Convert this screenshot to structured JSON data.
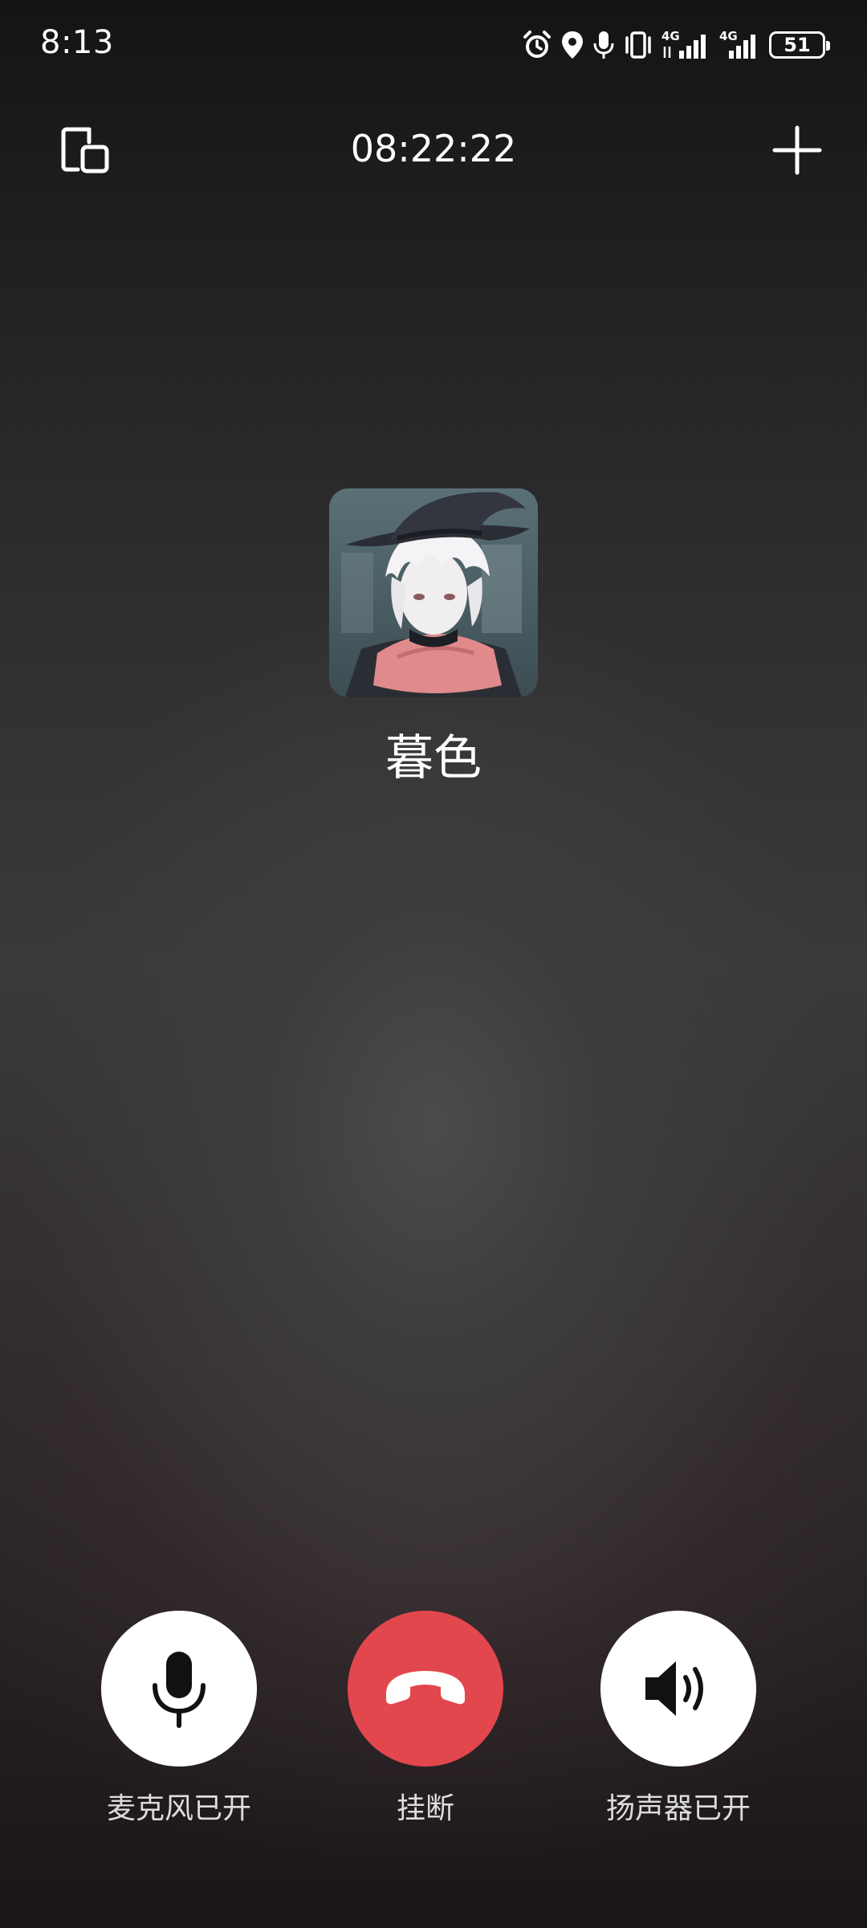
{
  "status_bar": {
    "time": "8:13",
    "network_1": "4G",
    "network_2": "4G",
    "battery": "51",
    "icons": [
      "alarm-icon",
      "location-icon",
      "mic-icon",
      "vibrate-icon",
      "signal-icon",
      "signal-icon",
      "battery-icon"
    ]
  },
  "call": {
    "timer": "08:22:22",
    "caller_name": "暮色"
  },
  "controls": {
    "mic_label": "麦克风已开",
    "hangup_label": "挂断",
    "speaker_label": "扬声器已开"
  },
  "colors": {
    "hangup": "#e2474d",
    "control_bg": "#ffffff"
  }
}
